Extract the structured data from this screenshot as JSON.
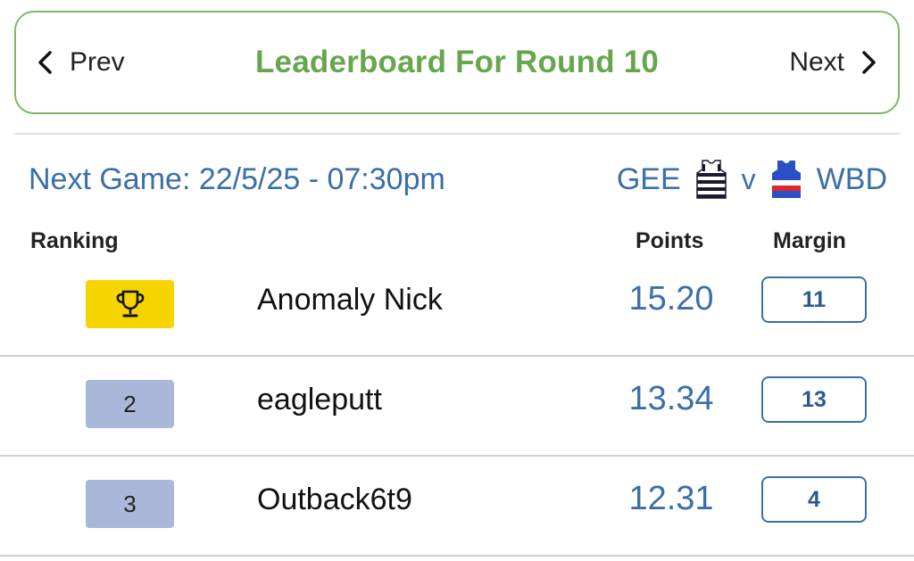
{
  "nav": {
    "prev_label": "Prev",
    "next_label": "Next",
    "title": "Leaderboard For Round 10"
  },
  "next_game": {
    "label": "Next Game: 22/5/25 - 07:30pm",
    "home_team": "GEE",
    "vs": "v",
    "away_team": "WBD"
  },
  "columns": {
    "ranking": "Ranking",
    "points": "Points",
    "margin": "Margin"
  },
  "rows": [
    {
      "rank": "1",
      "rank_icon": "trophy-icon",
      "player": "Anomaly Nick",
      "points": "15.20",
      "margin": "11"
    },
    {
      "rank": "2",
      "player": "eagleputt",
      "points": "13.34",
      "margin": "13"
    },
    {
      "rank": "3",
      "player": "Outback6t9",
      "points": "12.31",
      "margin": "4"
    }
  ],
  "colors": {
    "accent_green": "#67a64c",
    "accent_blue": "#3a6fa8",
    "gold_badge": "#f6d400",
    "rank_badge": "#a9b8d8"
  }
}
